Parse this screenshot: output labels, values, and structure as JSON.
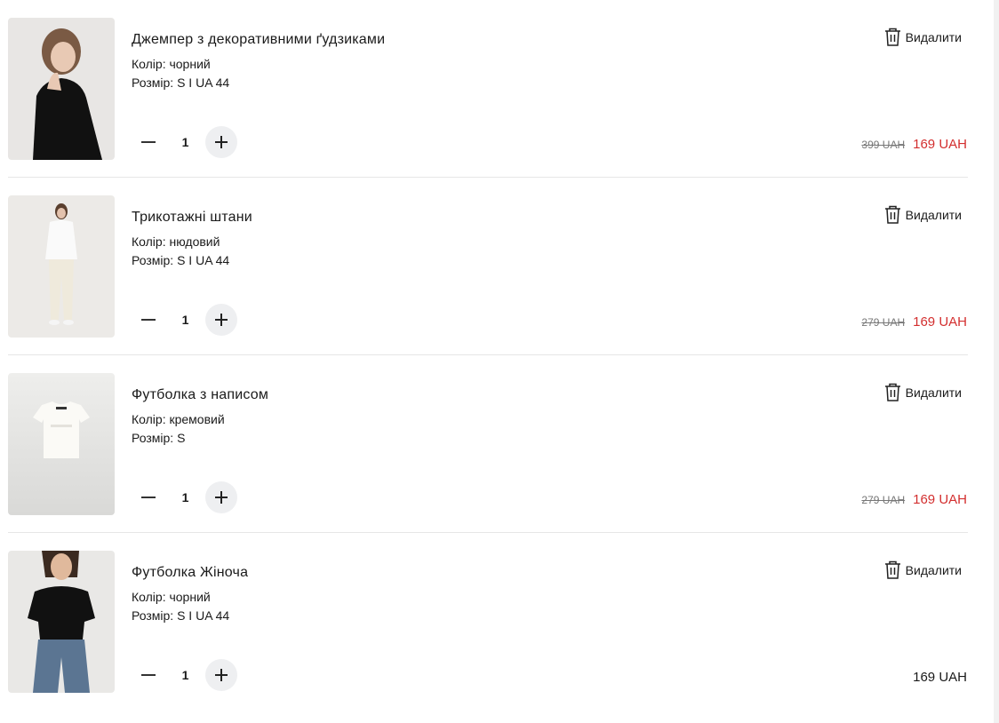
{
  "colors": {
    "sale_price": "#d32f2f",
    "old_price": "#777777",
    "text": "#1a1a1a",
    "divider": "#e6e6e6",
    "plus_button_bg": "#eeeff1"
  },
  "cart": {
    "remove_label": "Видалити",
    "items": [
      {
        "name": "Джемпер з декоративними ґудзиками",
        "color": "Колір: чорний",
        "size": "Розмір: S I UA 44",
        "quantity": "1",
        "old_price": "399 UAH",
        "price": "169 UAH",
        "image_icon": "product-photo-black-jumper"
      },
      {
        "name": "Трикотажні штани",
        "color": "Колір: нюдовий",
        "size": "Розмір: S I UA 44",
        "quantity": "1",
        "old_price": "279 UAH",
        "price": "169 UAH",
        "image_icon": "product-photo-knit-pants"
      },
      {
        "name": "Футболка з написом",
        "color": "Колір: кремовий",
        "size": "Розмір: S",
        "quantity": "1",
        "old_price": "279 UAH",
        "price": "169 UAH",
        "image_icon": "product-photo-cream-tshirt"
      },
      {
        "name": "Футболка Жіноча",
        "color": "Колір: чорний",
        "size": "Розмір: S I UA 44",
        "quantity": "1",
        "price": "169 UAH",
        "image_icon": "product-photo-black-tshirt"
      }
    ]
  }
}
